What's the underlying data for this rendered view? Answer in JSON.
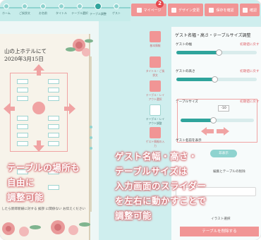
{
  "steps": [
    {
      "label": "ホーム"
    },
    {
      "label": "ご挨拶文"
    },
    {
      "label": "お名前"
    },
    {
      "label": "タイトル"
    },
    {
      "label": "テーブル選択"
    },
    {
      "label": "テーブル調整"
    },
    {
      "label": "ゲスト"
    }
  ],
  "topbar": {
    "my_page": "マイページ",
    "badge": "2",
    "design_change": "デザイン変更",
    "save_check": "保存を確認",
    "preview": "確認"
  },
  "paper": {
    "title": "山の上ホテルにて",
    "date": "2020年3月15日",
    "footer": "したら新郎新婦に対する 挨拶 に関係ない お伝えください"
  },
  "overlay": {
    "left_lines": [
      "テーブルの場所も",
      "自由に",
      "調整可能"
    ],
    "right_lines": [
      "ゲスト名幅・高さ・",
      "テーブルサイズは",
      "入力画面のスライダー",
      "を左右に動かすことで",
      "調整可能"
    ]
  },
  "side_icons": [
    {
      "label": "基本情報",
      "icon": "info-icon"
    },
    {
      "label": "タイトル・ご挨拶文",
      "icon": "pen-icon"
    },
    {
      "label": "テーブル・レイアウト選択",
      "icon": "table-icon"
    },
    {
      "label": "テーブル・レイアウト調整",
      "icon": "move-icon"
    },
    {
      "label": "ゲスト情報の入力",
      "icon": "people-icon"
    }
  ],
  "panel": {
    "title": "ゲスト名幅・高さ・テーブルサイズ調整",
    "row1_label": "ゲストの幅",
    "row1_link": "初期値に戻す",
    "row2_label": "ゲストの高さ",
    "row2_link": "初期値に戻す",
    "row3_label": "テーブルサイズ",
    "row3_link": "初期値に戻す",
    "value": "-10",
    "row4_label": "ゲスト名前を表示",
    "toggle_label": "非表示",
    "section_label": "編集とテーブルの削除",
    "input_label": "イラスト選択",
    "delete_button": "テーブルを削除する"
  },
  "colors": {
    "accent_pink": "#f19595",
    "accent_teal": "#2fa49c",
    "background": "#cfeeee"
  }
}
